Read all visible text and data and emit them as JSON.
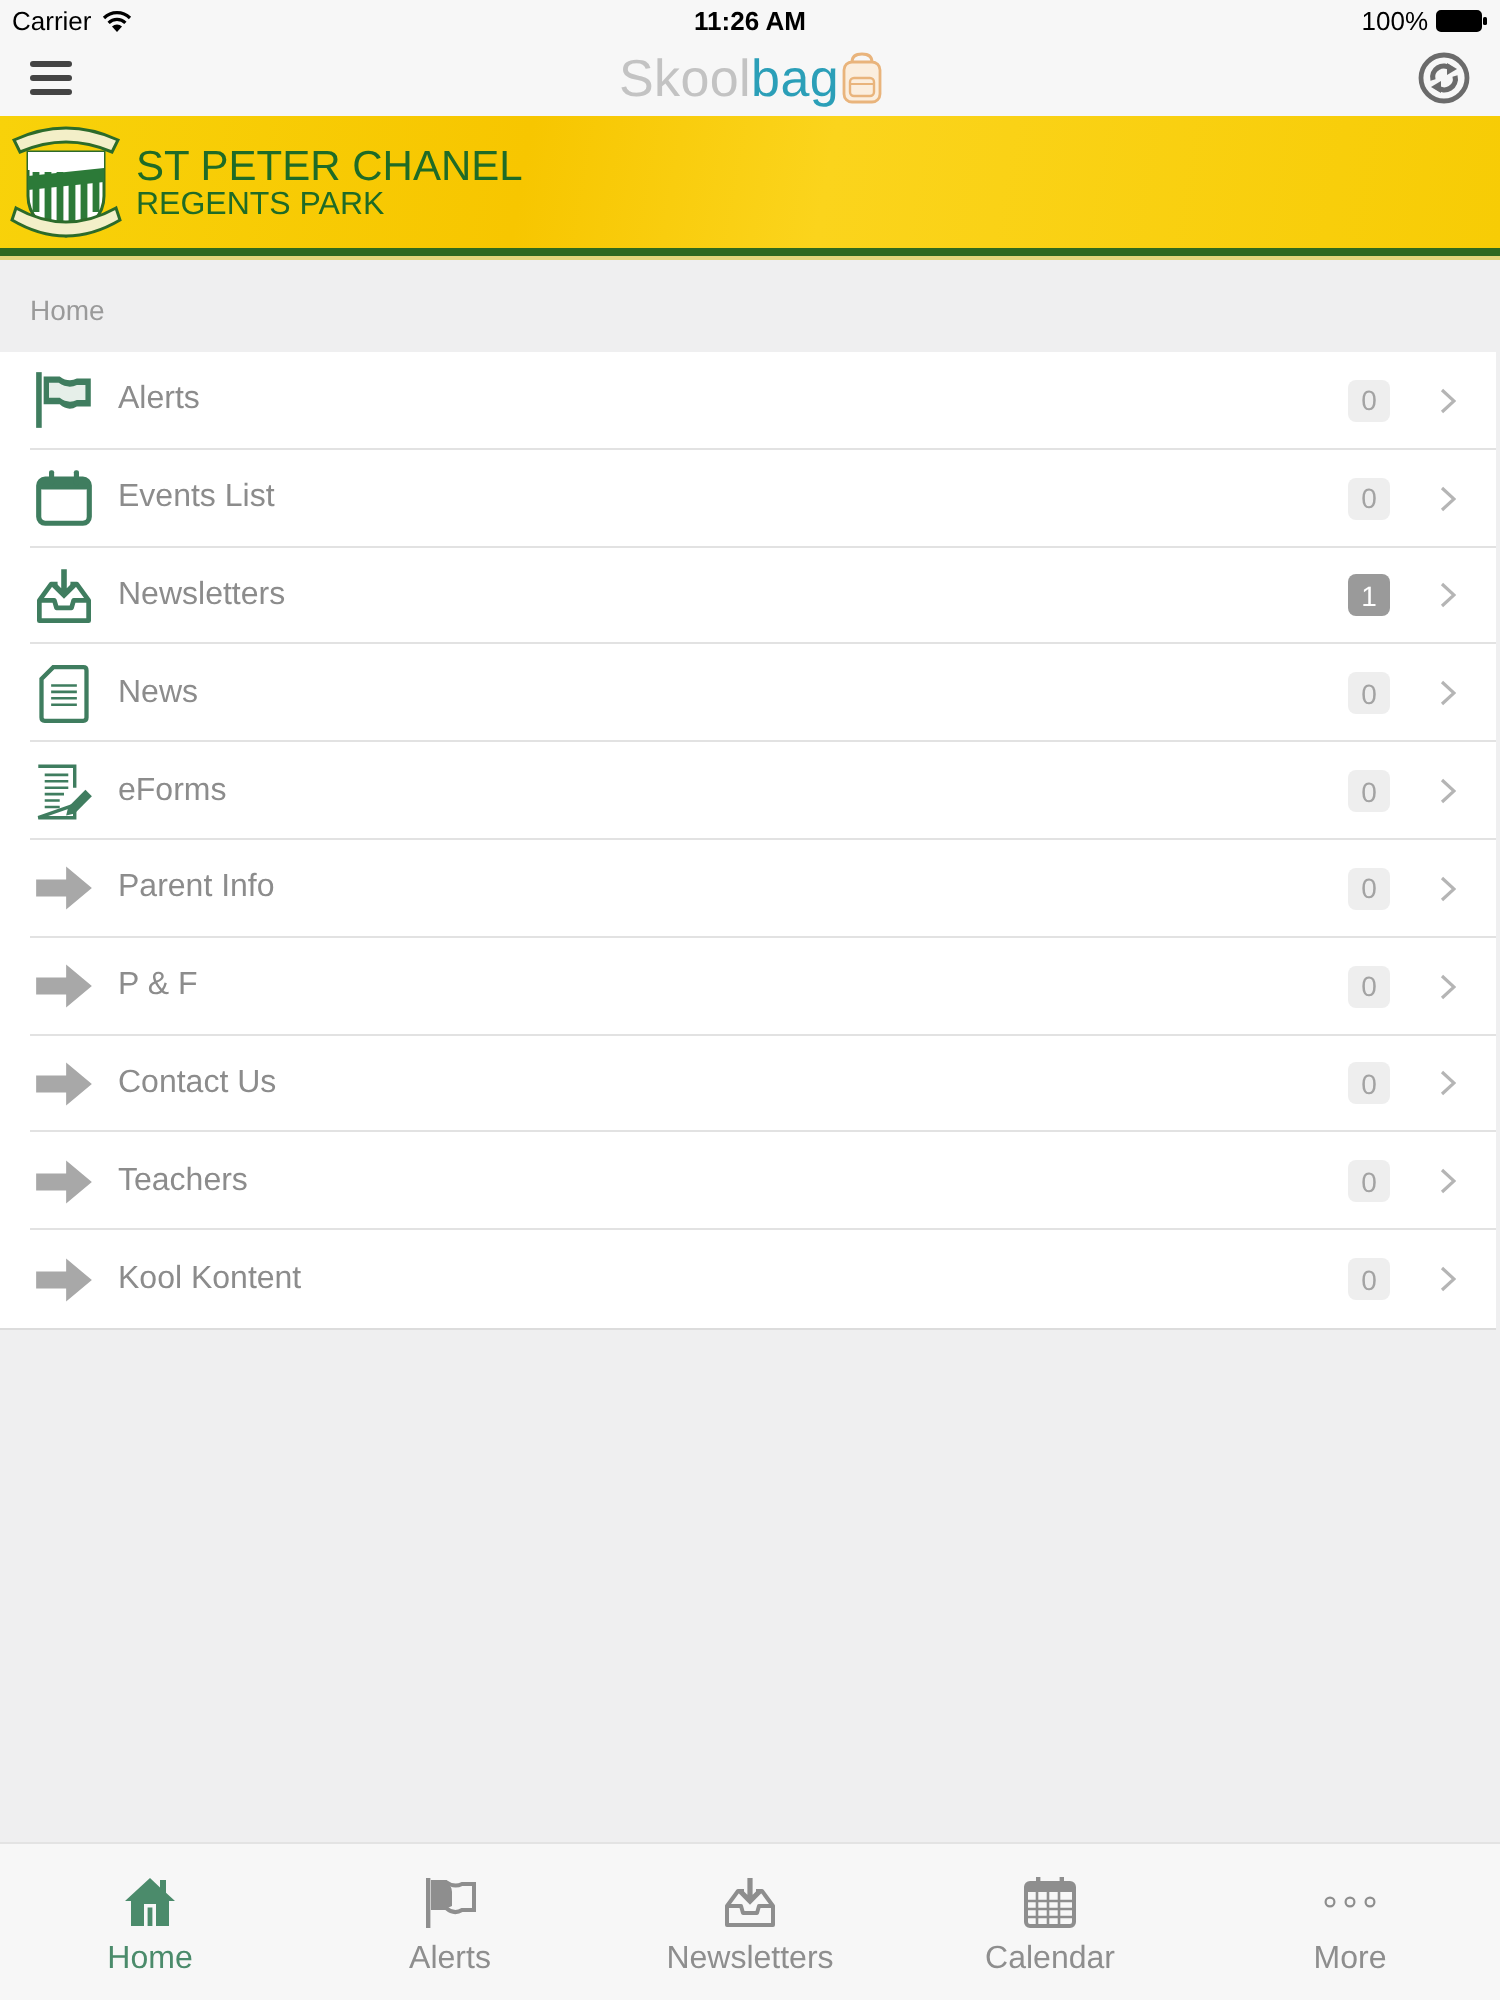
{
  "status_bar": {
    "carrier": "Carrier",
    "time": "11:26 AM",
    "battery": "100%"
  },
  "nav_bar": {
    "logo": {
      "first": "Skool",
      "second": "bag"
    }
  },
  "banner": {
    "title": "ST PETER CHANEL",
    "subtitle": "REGENTS PARK"
  },
  "breadcrumb": "Home",
  "menu": [
    {
      "label": "Alerts",
      "kind": "flag",
      "count": "0",
      "highlighted": false
    },
    {
      "label": "Events List",
      "kind": "calendar",
      "count": "0",
      "highlighted": false
    },
    {
      "label": "Newsletters",
      "kind": "inbox",
      "count": "1",
      "highlighted": true
    },
    {
      "label": "News",
      "kind": "document",
      "count": "0",
      "highlighted": false
    },
    {
      "label": "eForms",
      "kind": "form",
      "count": "0",
      "highlighted": false
    },
    {
      "label": "Parent Info",
      "kind": "link",
      "count": "0",
      "highlighted": false
    },
    {
      "label": "P & F",
      "kind": "link",
      "count": "0",
      "highlighted": false
    },
    {
      "label": "Contact Us",
      "kind": "link",
      "count": "0",
      "highlighted": false
    },
    {
      "label": "Teachers",
      "kind": "link",
      "count": "0",
      "highlighted": false
    },
    {
      "label": "Kool Kontent",
      "kind": "link",
      "count": "0",
      "highlighted": false
    }
  ],
  "tab_bar": [
    {
      "label": "Home",
      "kind": "home",
      "selected": true
    },
    {
      "label": "Alerts",
      "kind": "flag",
      "selected": false
    },
    {
      "label": "Newsletters",
      "kind": "inbox",
      "selected": false
    },
    {
      "label": "Calendar",
      "kind": "calendar",
      "selected": false
    },
    {
      "label": "More",
      "kind": "more",
      "selected": false
    }
  ]
}
